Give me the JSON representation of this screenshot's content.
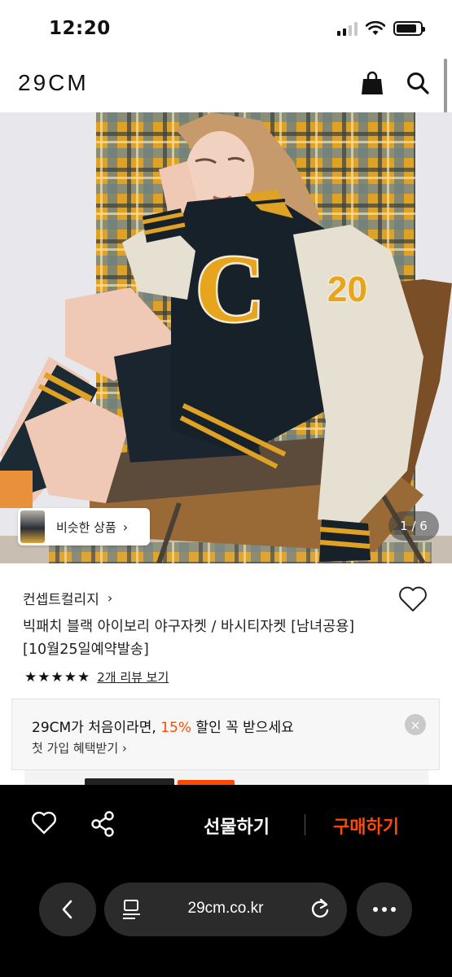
{
  "status_bar": {
    "time": "12:20"
  },
  "header": {
    "logo": "29CM"
  },
  "hero": {
    "jacket_letter": "C",
    "sleeve_number": "20",
    "similar_products_label": "비슷한 상품",
    "image_counter": "1 / 6"
  },
  "product": {
    "brand": "컨셉트컬리지",
    "title_line1": "빅패치 블랙 아이보리 야구자켓 / 바시티자켓 [남녀공용]",
    "title_line2": "[10월25일예약발송]",
    "stars": "★★★★★",
    "review_link": "2개 리뷰 보기"
  },
  "promo": {
    "text_prefix": "29CM가 처음이라면, ",
    "text_highlight": "15%",
    "text_suffix": " 할인 꼭 받으세요",
    "sub_link": "첫 가입 혜택받기 ›"
  },
  "purchase_bar": {
    "gift_label": "선물하기",
    "buy_label": "구매하기"
  },
  "browser": {
    "url": "29cm.co.kr"
  },
  "colors": {
    "accent": "#ff4800",
    "bar_bg": "#000000",
    "pill_bg": "#2b2b2b"
  }
}
